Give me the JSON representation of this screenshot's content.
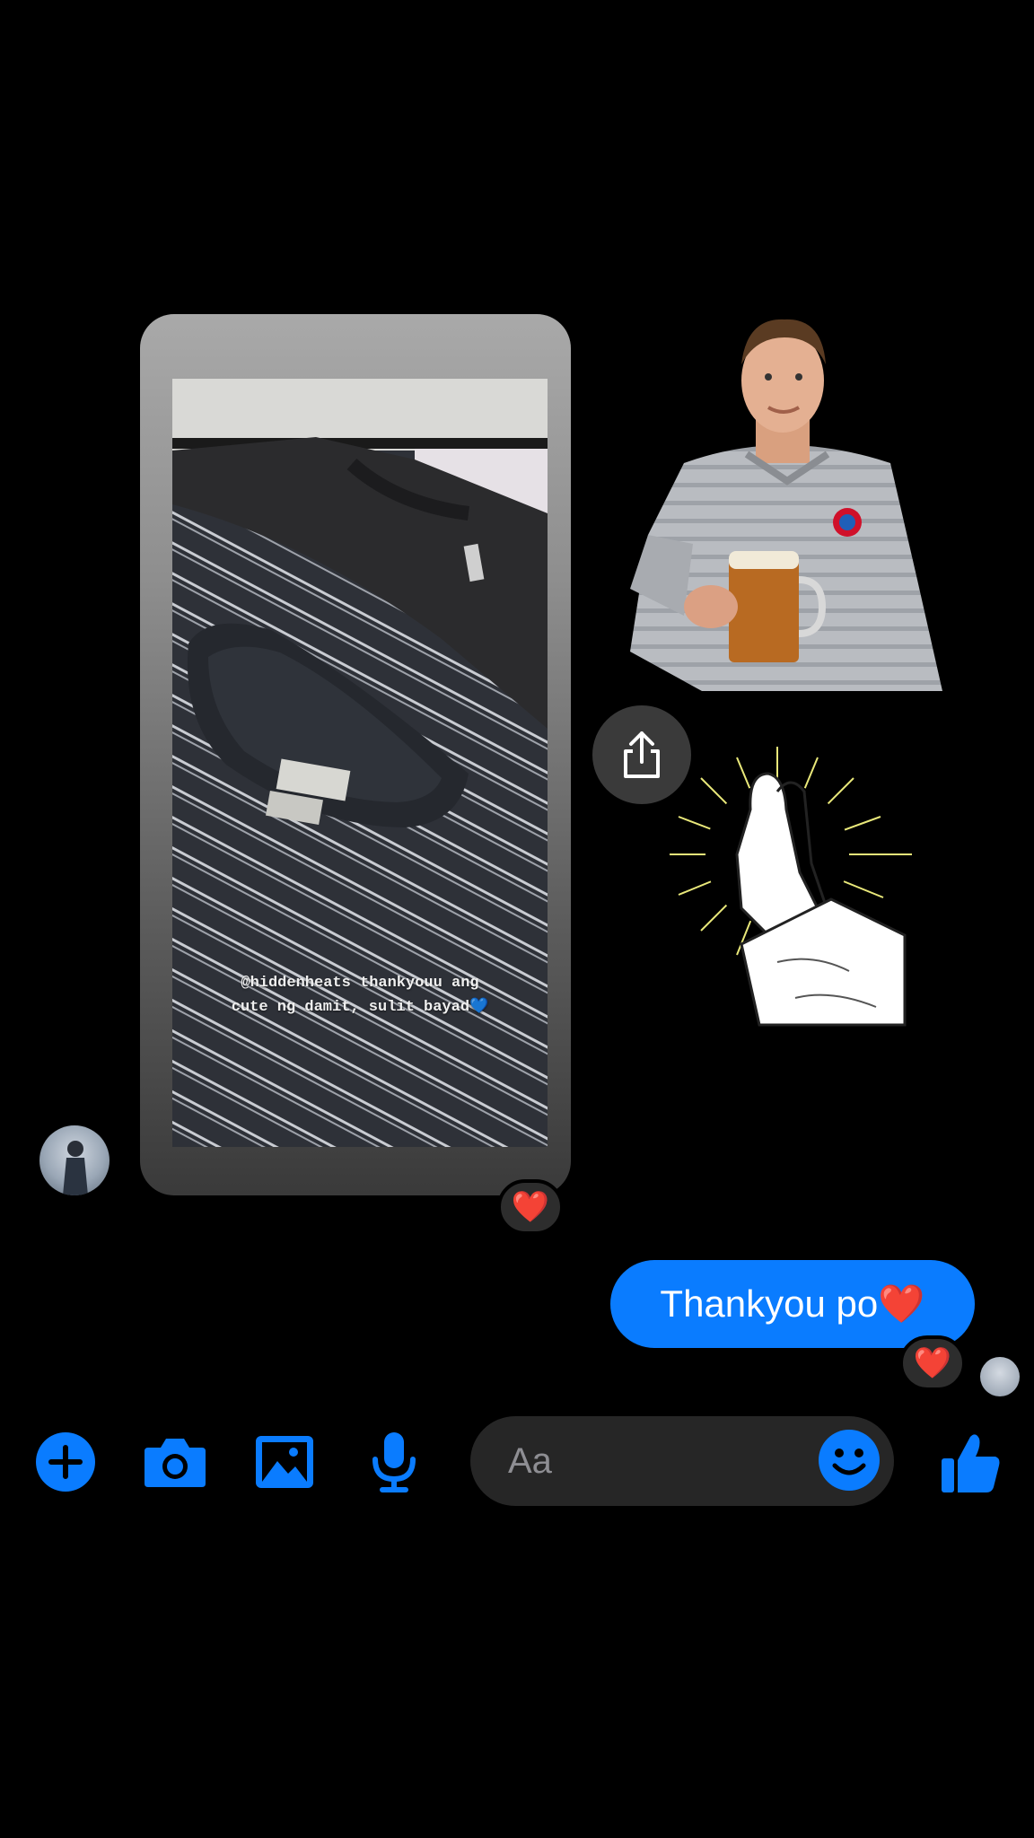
{
  "story": {
    "caption": "@hiddenheats thankyouu ang\ncute ng damit, sulit bayad💙"
  },
  "reactions": {
    "story_reaction": "❤️",
    "message_reaction": "❤️"
  },
  "messages": [
    {
      "text": "Thankyou po❤️",
      "sender": "me"
    }
  ],
  "composer": {
    "placeholder": "Aa",
    "icons": [
      "plus-icon",
      "camera-icon",
      "gallery-icon",
      "microphone-icon",
      "emoji-icon",
      "thumbs-up-icon"
    ]
  },
  "colors": {
    "accent": "#0a7cff",
    "background": "#000000",
    "input_background": "#262626"
  }
}
